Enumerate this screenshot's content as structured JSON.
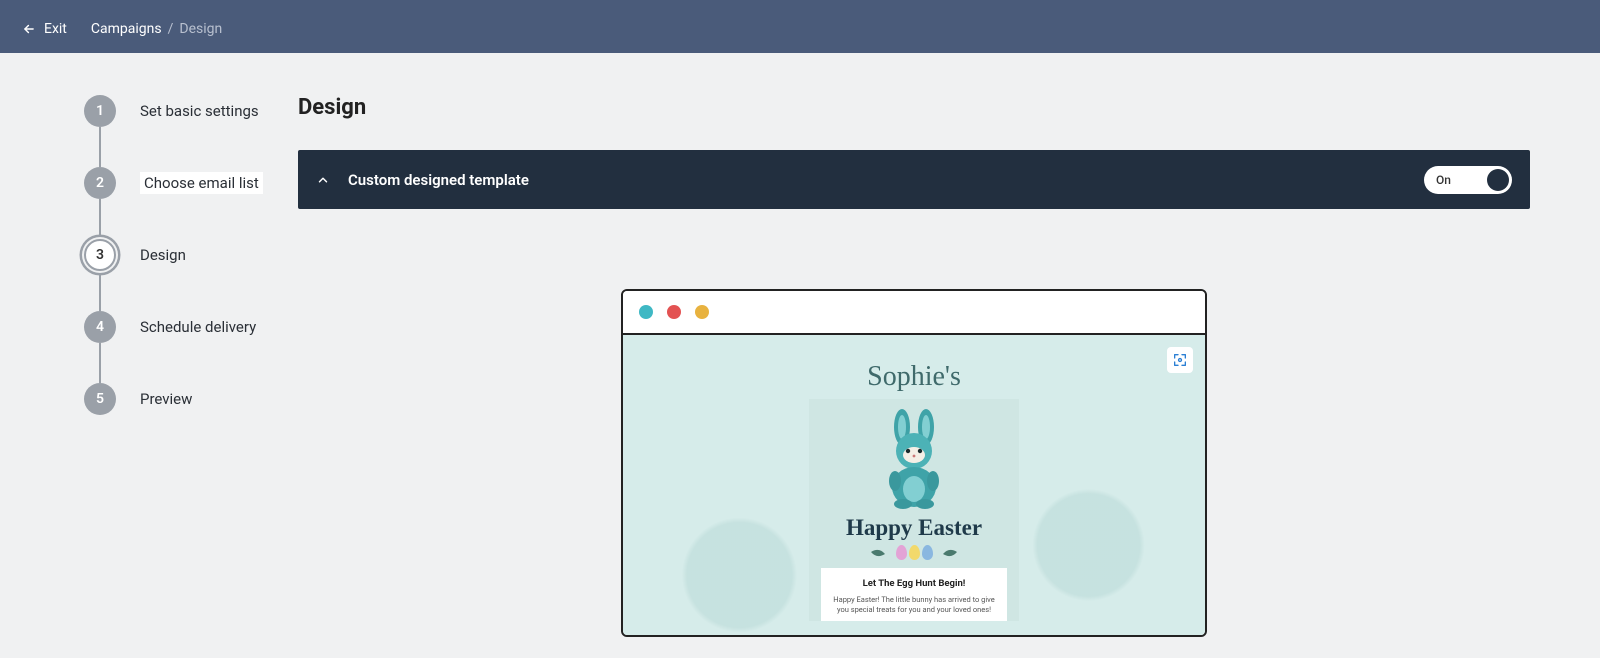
{
  "header": {
    "exit_label": "Exit",
    "breadcrumb_main": "Campaigns",
    "breadcrumb_sep": "/",
    "breadcrumb_current": "Design"
  },
  "sidebar": {
    "steps": [
      {
        "num": "1",
        "label": "Set basic settings"
      },
      {
        "num": "2",
        "label": "Choose email list"
      },
      {
        "num": "3",
        "label": "Design"
      },
      {
        "num": "4",
        "label": "Schedule delivery"
      },
      {
        "num": "5",
        "label": "Preview"
      }
    ]
  },
  "main": {
    "page_title": "Design",
    "accordion_title": "Custom designed template",
    "toggle_label": "On"
  },
  "preview": {
    "brand": "Sophie's",
    "headline": "Happy Easter",
    "box_title": "Let The Egg Hunt Begin!",
    "box_text": "Happy Easter! The little bunny has arrived to give you special treats for you and your loved ones!"
  }
}
